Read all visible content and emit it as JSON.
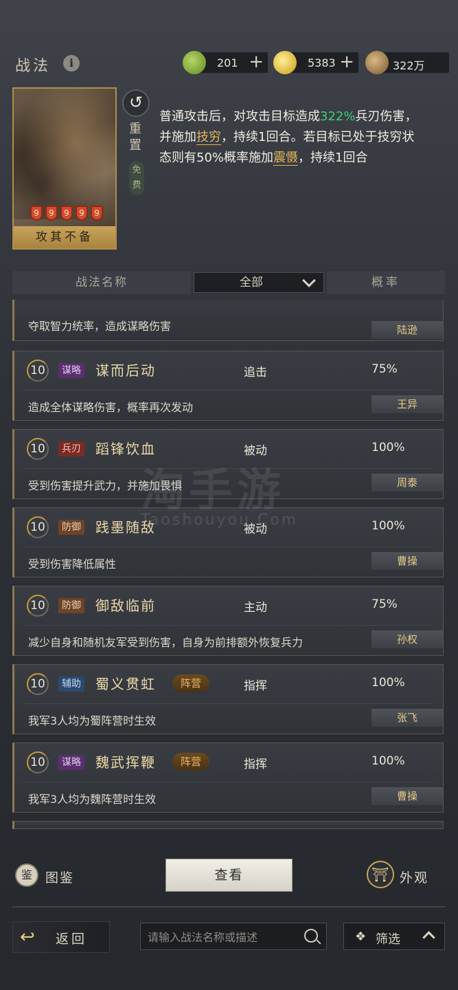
{
  "header": {
    "title": "战法",
    "info_icon": "i",
    "resources": [
      {
        "icon": "jade-coin-icon",
        "value": "201",
        "plus": "+",
        "color": "#7fa83a"
      },
      {
        "icon": "gold-coin-icon",
        "value": "5383",
        "plus": "+",
        "color": "#d9b12a"
      },
      {
        "icon": "copper-coin-icon",
        "value": "322万",
        "color": "#9a7a4a"
      }
    ]
  },
  "tactic_card": {
    "name": "攻其不备",
    "stars": [
      "9",
      "9",
      "9",
      "9",
      "9"
    ],
    "reset_label": "重置",
    "reset_icon": "↺",
    "free_label": "免费",
    "desc_1": "普通攻击后，对攻击目标造成",
    "desc_pct": "322%",
    "desc_2": "兵刃伤害，并施加",
    "desc_k1": "技穷",
    "desc_3": "，持续1回合。若目标已处于技穷状态则有50%概率施加",
    "desc_k2": "震慑",
    "desc_4": "，持续1回合"
  },
  "list_header": {
    "name": "战法名称",
    "filter": "全部",
    "rate": "概率"
  },
  "skills": [
    {
      "detail": "夺取智力统率，造成谋略伤害",
      "hero": "陆逊"
    },
    {
      "level": "10",
      "tag": "谋略",
      "tag_class": "strat",
      "name": "谋而后动",
      "type": "追击",
      "rate": "75%",
      "detail": "造成全体谋略伤害，概率再次发动",
      "hero": "王异"
    },
    {
      "level": "10",
      "tag": "兵刃",
      "tag_class": "blade",
      "name": "蹈锋饮血",
      "type": "被动",
      "rate": "100%",
      "detail": "受到伤害提升武力，并施加畏惧",
      "hero": "周泰"
    },
    {
      "level": "10",
      "tag": "防御",
      "tag_class": "def",
      "name": "践墨随敌",
      "type": "被动",
      "rate": "100%",
      "detail": "受到伤害降低属性",
      "hero": "曹操"
    },
    {
      "level": "10",
      "tag": "防御",
      "tag_class": "def",
      "name": "御敌临前",
      "type": "主动",
      "rate": "75%",
      "detail": "减少自身和随机友军受到伤害，自身为前排额外恢复兵力",
      "hero": "孙权"
    },
    {
      "level": "10",
      "tag": "辅助",
      "tag_class": "aux",
      "name": "蜀义贯虹",
      "camp": "阵营",
      "type": "指挥",
      "rate": "100%",
      "detail": "我军3人均为蜀阵营时生效",
      "hero": "张飞"
    },
    {
      "level": "10",
      "tag": "谋略",
      "tag_class": "strat",
      "name": "魏武挥鞭",
      "camp": "阵营",
      "type": "指挥",
      "rate": "100%",
      "detail": "我军3人均为魏阵营时生效",
      "hero": "曹操"
    }
  ],
  "watermark": {
    "main": "淘手游",
    "sub": "Taoshouyou.Com"
  },
  "actions": {
    "atlas_icon": "鉴",
    "atlas": "图鉴",
    "view": "查看",
    "look_icon": "⛩",
    "look": "外观"
  },
  "bottom": {
    "back": "返回",
    "search_placeholder": "请输入战法名称或描述",
    "filter_icon": "❖",
    "filter": "筛选"
  }
}
